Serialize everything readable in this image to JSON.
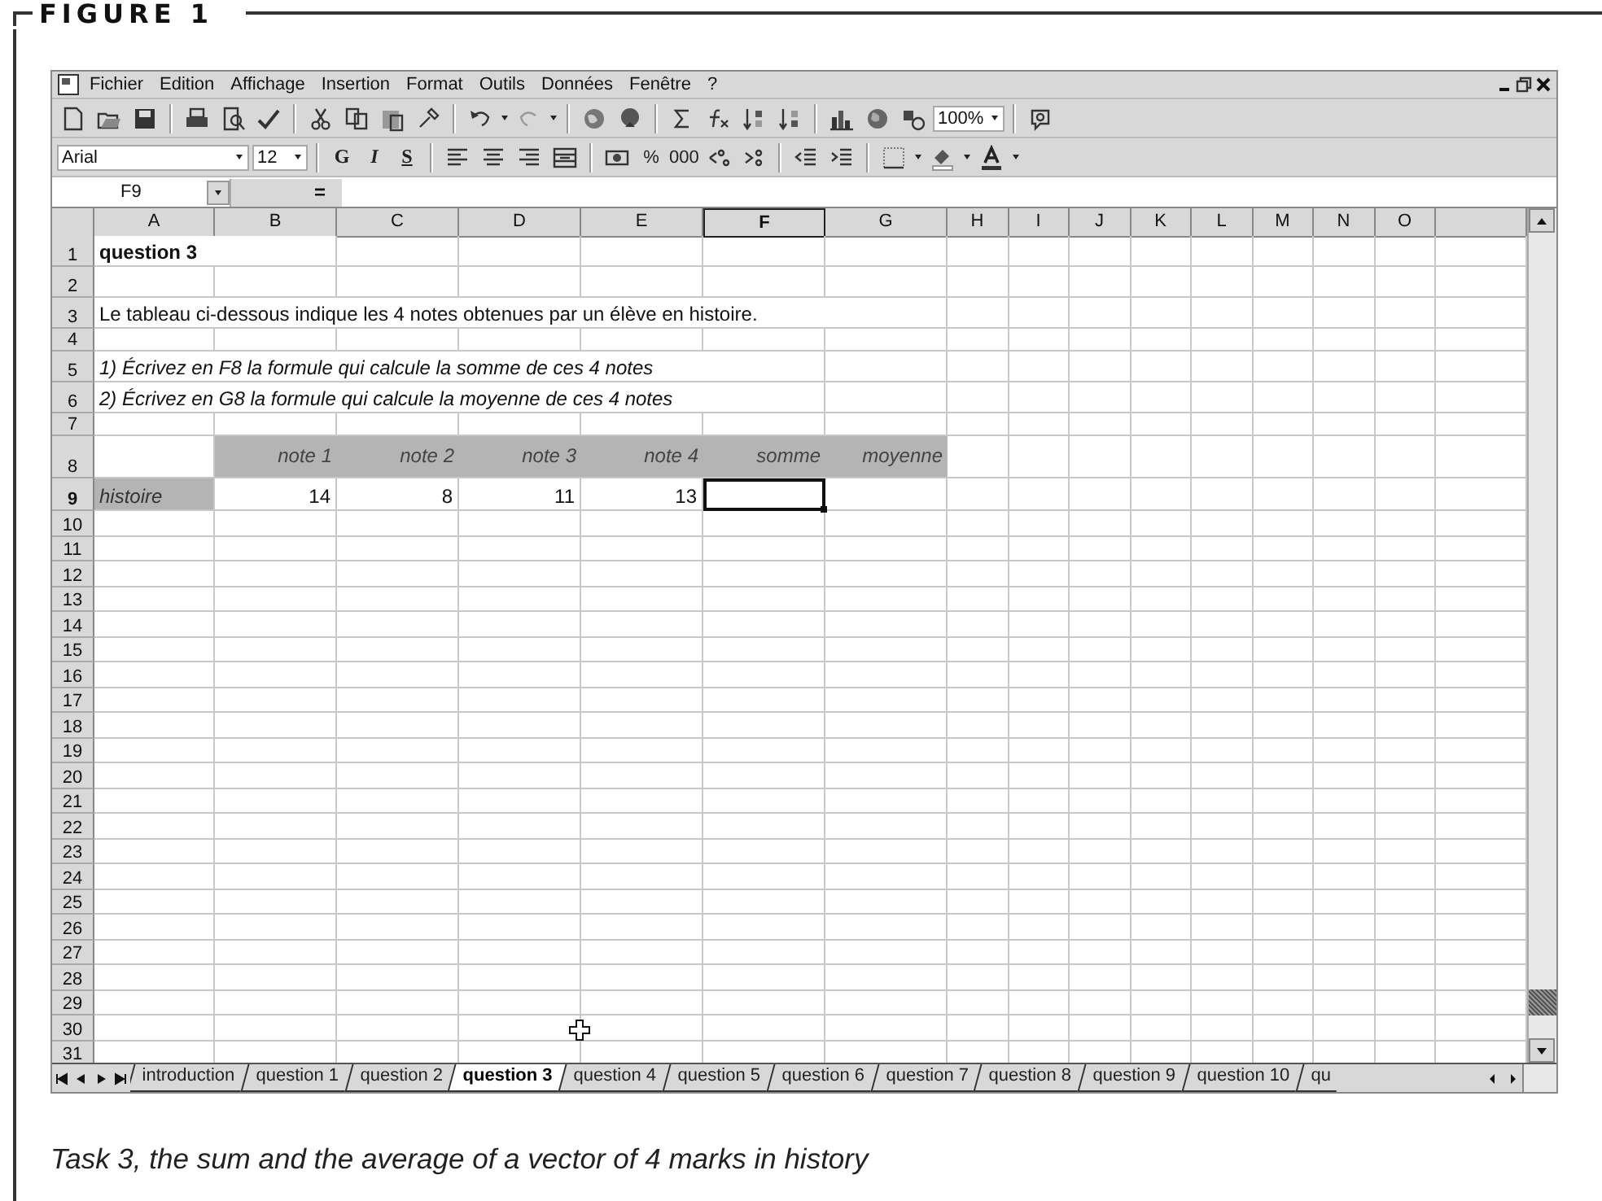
{
  "figure": {
    "title": "FIGURE 1",
    "caption": "Task 3, the sum and the average of a vector of 4 marks in history"
  },
  "menu": [
    "Fichier",
    "Edition",
    "Affichage",
    "Insertion",
    "Format",
    "Outils",
    "Données",
    "Fenêtre",
    "?"
  ],
  "toolbar": {
    "zoom": "100%"
  },
  "format_bar": {
    "font": "Arial",
    "size": "12",
    "styles": [
      {
        "label": "G",
        "kind": "bold"
      },
      {
        "label": "I",
        "kind": "italic"
      },
      {
        "label": "S",
        "kind": "underline"
      }
    ],
    "number_buttons": [
      "%",
      "000"
    ]
  },
  "formula_bar": {
    "name_box": "F9",
    "equals": "="
  },
  "sheet": {
    "columns": [
      {
        "label": "A",
        "active": false
      },
      {
        "label": "B",
        "active": false
      },
      {
        "label": "C",
        "active": false
      },
      {
        "label": "D",
        "active": false
      },
      {
        "label": "E",
        "active": false
      },
      {
        "label": "F",
        "active": true
      },
      {
        "label": "G",
        "active": false
      },
      {
        "label": "H",
        "active": false
      },
      {
        "label": "I",
        "active": false
      },
      {
        "label": "J",
        "active": false
      },
      {
        "label": "K",
        "active": false
      },
      {
        "label": "L",
        "active": false
      },
      {
        "label": "M",
        "active": false
      },
      {
        "label": "N",
        "active": false
      },
      {
        "label": "O",
        "active": false
      }
    ],
    "rows": [
      {
        "number": "1",
        "active": false,
        "cells": [
          {
            "kind": "title",
            "text": "question 3"
          }
        ]
      },
      {
        "number": "2",
        "active": false
      },
      {
        "number": "3",
        "active": false,
        "cells": [
          {
            "kind": "text",
            "text": "Le tableau ci-dessous indique les 4 notes obtenues par un élève en histoire."
          }
        ]
      },
      {
        "number": "4",
        "active": false
      },
      {
        "number": "5",
        "active": false,
        "cells": [
          {
            "kind": "note",
            "text": "1) Écrivez en F8 la formule qui calcule la somme de ces 4 notes"
          }
        ]
      },
      {
        "number": "6",
        "active": false,
        "cells": [
          {
            "kind": "note",
            "text": "2) Écrivez en G8 la formule qui calcule la moyenne de ces 4 notes"
          }
        ]
      },
      {
        "number": "7",
        "active": false
      },
      {
        "number": "8",
        "active": false,
        "cells": [
          null,
          {
            "kind": "band",
            "text": "note 1"
          },
          {
            "kind": "band",
            "text": "note 2"
          },
          {
            "kind": "band",
            "text": "note 3"
          },
          {
            "kind": "band",
            "text": "note 4"
          },
          {
            "kind": "band",
            "text": "somme"
          },
          {
            "kind": "band",
            "text": "moyenne"
          }
        ]
      },
      {
        "number": "9",
        "active": true,
        "cells": [
          {
            "kind": "label",
            "text": "histoire"
          },
          {
            "kind": "number",
            "text": "14"
          },
          {
            "kind": "number",
            "text": "8"
          },
          {
            "kind": "number",
            "text": "11"
          },
          {
            "kind": "number",
            "text": "13"
          },
          {
            "kind": "empty",
            "selected": true
          }
        ]
      },
      {
        "number": "10",
        "active": false
      },
      {
        "number": "11",
        "active": false
      },
      {
        "number": "12",
        "active": false
      },
      {
        "number": "13",
        "active": false
      },
      {
        "number": "14",
        "active": false
      },
      {
        "number": "15",
        "active": false
      },
      {
        "number": "16",
        "active": false
      },
      {
        "number": "17",
        "active": false
      },
      {
        "number": "18",
        "active": false
      },
      {
        "number": "19",
        "active": false
      },
      {
        "number": "20",
        "active": false
      },
      {
        "number": "21",
        "active": false
      },
      {
        "number": "22",
        "active": false
      },
      {
        "number": "23",
        "active": false
      },
      {
        "number": "24",
        "active": false
      },
      {
        "number": "25",
        "active": false
      },
      {
        "number": "26",
        "active": false
      },
      {
        "number": "27",
        "active": false
      },
      {
        "number": "28",
        "active": false
      },
      {
        "number": "29",
        "active": false
      },
      {
        "number": "30",
        "active": false
      },
      {
        "number": "31",
        "active": false
      }
    ]
  },
  "tabs": [
    {
      "label": "introduction",
      "selected": false
    },
    {
      "label": "question 1",
      "selected": false
    },
    {
      "label": "question 2",
      "selected": false
    },
    {
      "label": "question 3",
      "selected": true
    },
    {
      "label": "question 4",
      "selected": false
    },
    {
      "label": "question 5",
      "selected": false
    },
    {
      "label": "question 6",
      "selected": false
    },
    {
      "label": "question 7",
      "selected": false
    },
    {
      "label": "question 8",
      "selected": false
    },
    {
      "label": "question 9",
      "selected": false
    },
    {
      "label": "question 10",
      "selected": false
    },
    {
      "label": "qu",
      "selected": false
    }
  ]
}
